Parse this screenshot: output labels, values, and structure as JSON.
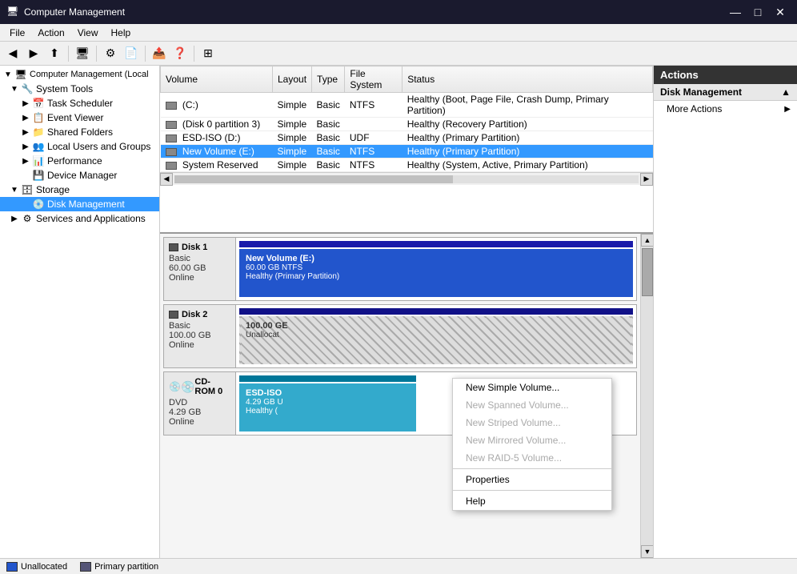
{
  "titleBar": {
    "icon": "🖥",
    "title": "Computer Management",
    "minBtn": "—",
    "maxBtn": "□",
    "closeBtn": "✕"
  },
  "menuBar": {
    "items": [
      "File",
      "Action",
      "View",
      "Help"
    ]
  },
  "toolbar": {
    "buttons": [
      "◀",
      "▶",
      "⬆",
      "🖥",
      "📋",
      "🔧",
      "📄",
      "📤",
      "📥",
      "ℹ",
      "📑",
      "⊞"
    ]
  },
  "tree": {
    "items": [
      {
        "id": "computer-management",
        "label": "Computer Management (Local",
        "level": 0,
        "expanded": true,
        "icon": "🖥"
      },
      {
        "id": "system-tools",
        "label": "System Tools",
        "level": 1,
        "expanded": true,
        "icon": "🔧"
      },
      {
        "id": "task-scheduler",
        "label": "Task Scheduler",
        "level": 2,
        "expanded": false,
        "icon": "📅"
      },
      {
        "id": "event-viewer",
        "label": "Event Viewer",
        "level": 2,
        "expanded": false,
        "icon": "📋"
      },
      {
        "id": "shared-folders",
        "label": "Shared Folders",
        "level": 2,
        "expanded": false,
        "icon": "📁"
      },
      {
        "id": "local-users",
        "label": "Local Users and Groups",
        "level": 2,
        "expanded": false,
        "icon": "👥"
      },
      {
        "id": "performance",
        "label": "Performance",
        "level": 2,
        "expanded": false,
        "icon": "📊"
      },
      {
        "id": "device-manager",
        "label": "Device Manager",
        "level": 2,
        "expanded": false,
        "icon": "💾"
      },
      {
        "id": "storage",
        "label": "Storage",
        "level": 1,
        "expanded": true,
        "icon": "🗄"
      },
      {
        "id": "disk-management",
        "label": "Disk Management",
        "level": 2,
        "expanded": false,
        "icon": "💿",
        "selected": true
      },
      {
        "id": "services-apps",
        "label": "Services and Applications",
        "level": 1,
        "expanded": false,
        "icon": "⚙"
      }
    ]
  },
  "volumeTable": {
    "columns": [
      "Volume",
      "Layout",
      "Type",
      "File System",
      "Status"
    ],
    "rows": [
      {
        "icon": "disk",
        "volume": "(C:)",
        "layout": "Simple",
        "type": "Basic",
        "fs": "NTFS",
        "status": "Healthy (Boot, Page File, Crash Dump, Primary Partition)"
      },
      {
        "icon": "disk",
        "volume": "(Disk 0 partition 3)",
        "layout": "Simple",
        "type": "Basic",
        "fs": "",
        "status": "Healthy (Recovery Partition)"
      },
      {
        "icon": "disk",
        "volume": "ESD-ISO (D:)",
        "layout": "Simple",
        "type": "Basic",
        "fs": "UDF",
        "status": "Healthy (Primary Partition)"
      },
      {
        "icon": "disk",
        "volume": "New Volume (E:)",
        "layout": "Simple",
        "type": "Basic",
        "fs": "NTFS",
        "status": "Healthy (Primary Partition)",
        "selected": true
      },
      {
        "icon": "disk",
        "volume": "System Reserved",
        "layout": "Simple",
        "type": "Basic",
        "fs": "NTFS",
        "status": "Healthy (System, Active, Primary Partition)"
      }
    ]
  },
  "diskMap": {
    "disks": [
      {
        "id": "disk1",
        "name": "Disk 1",
        "type": "Basic",
        "size": "60.00 GB",
        "status": "Online",
        "partitions": [
          {
            "label": "New Volume  (E:)",
            "size": "60.00 GB NTFS",
            "status": "Healthy (Primary Partition)",
            "style": "blue",
            "width": "100%"
          }
        ]
      },
      {
        "id": "disk2",
        "name": "Disk 2",
        "type": "Basic",
        "size": "100.00 GB",
        "status": "Online",
        "partitions": [
          {
            "label": "100.00 GB",
            "size": "Unallocat",
            "status": "",
            "style": "hatch",
            "width": "100%"
          }
        ]
      },
      {
        "id": "cdrom0",
        "name": "CD-ROM 0",
        "type": "DVD",
        "size": "4.29 GB",
        "status": "Online",
        "partitions": [
          {
            "label": "ESD-ISO",
            "size": "4.29 GB U",
            "status": "Healthy (",
            "style": "cyan",
            "width": "40%"
          }
        ]
      }
    ]
  },
  "contextMenu": {
    "items": [
      {
        "label": "New Simple Volume...",
        "enabled": true
      },
      {
        "label": "New Spanned Volume...",
        "enabled": false
      },
      {
        "label": "New Striped Volume...",
        "enabled": false
      },
      {
        "label": "New Mirrored Volume...",
        "enabled": false
      },
      {
        "label": "New RAID-5 Volume...",
        "enabled": false
      },
      {
        "separator": true
      },
      {
        "label": "Properties",
        "enabled": true
      },
      {
        "separator": true
      },
      {
        "label": "Help",
        "enabled": true
      }
    ]
  },
  "actionsPanel": {
    "header": "Actions",
    "sections": [
      {
        "label": "Disk Management",
        "items": [
          {
            "label": "More Actions",
            "arrow": "▶"
          }
        ]
      }
    ]
  },
  "statusBar": {
    "legend": [
      {
        "color": "#2255cc",
        "label": "Unallocated"
      },
      {
        "color": "#aaaaaa",
        "label": "Primary partition"
      }
    ]
  }
}
